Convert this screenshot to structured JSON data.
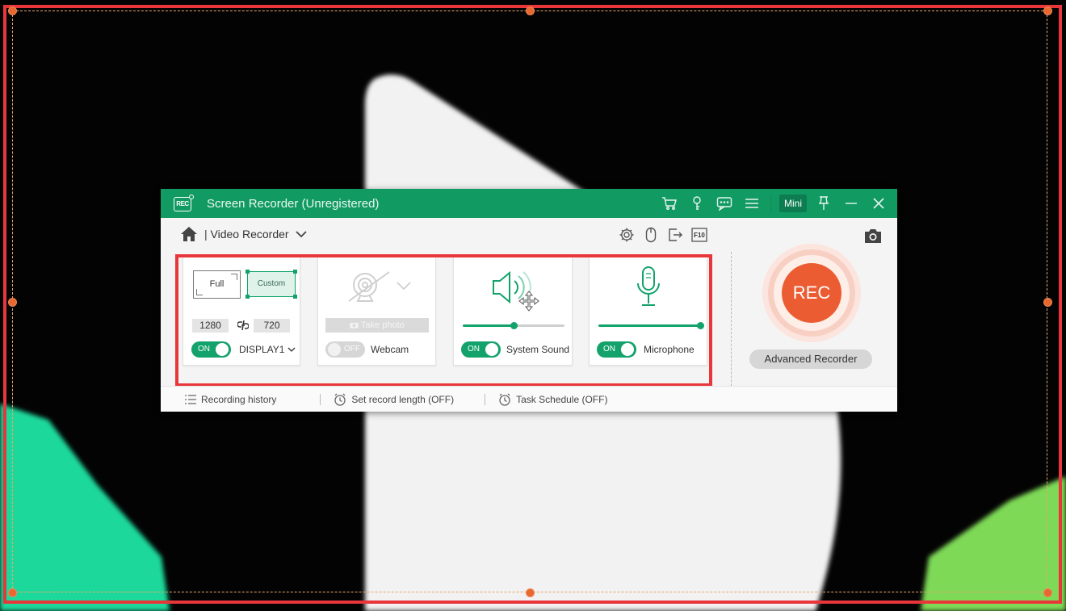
{
  "window": {
    "title": "Screen Recorder (Unregistered)",
    "logo_text": "REC",
    "mini_label": "Mini",
    "titlebar_icons": [
      "cart-icon",
      "key-icon",
      "chat-icon",
      "menu-icon"
    ],
    "window_controls": [
      "pin-icon",
      "minimize-icon",
      "close-icon"
    ]
  },
  "mode": {
    "separator": "|",
    "label": "Video Recorder"
  },
  "toolbar": {
    "icons": [
      "gear-icon",
      "mouse-icon",
      "export-icon",
      "f10-hotkey-icon"
    ],
    "hotkey_label": "F10"
  },
  "display_panel": {
    "full_label": "Full",
    "custom_label": "Custom",
    "width": "1280",
    "height": "720",
    "toggle_state": "ON",
    "display_name": "DISPLAY1"
  },
  "webcam_panel": {
    "take_photo_label": "Take photo",
    "toggle_state": "OFF",
    "label": "Webcam"
  },
  "sound_panel": {
    "toggle_state": "ON",
    "label": "System Sound",
    "volume": 0.5
  },
  "mic_panel": {
    "toggle_state": "ON",
    "label": "Microphone",
    "volume": 1.0
  },
  "rec": {
    "label": "REC",
    "advanced_label": "Advanced Recorder"
  },
  "footer": {
    "history_label": "Recording history",
    "length_label": "Set record length (OFF)",
    "schedule_label": "Task Schedule (OFF)"
  },
  "colors": {
    "brand_green": "#129a63",
    "toggle_on": "#13a26b",
    "rec_orange": "#ec5c33",
    "capture_border": "#e8363a",
    "handle": "#e8682f"
  }
}
